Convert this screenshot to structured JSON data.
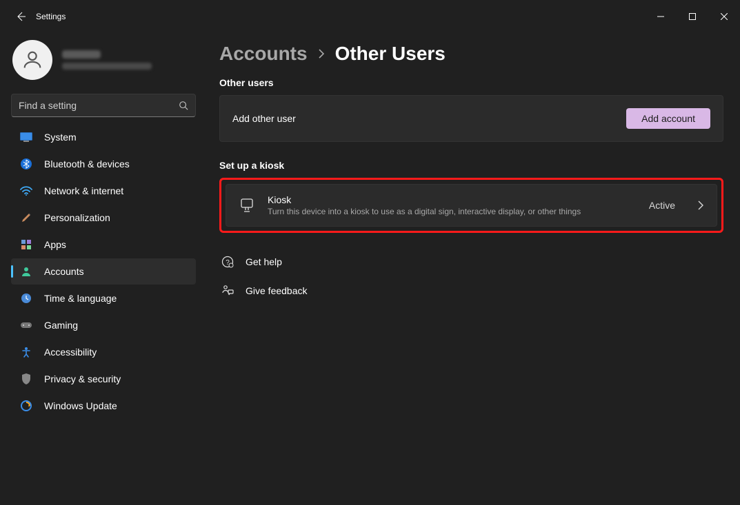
{
  "window": {
    "title": "Settings"
  },
  "search": {
    "placeholder": "Find a setting"
  },
  "sidebar": {
    "items": [
      {
        "label": "System"
      },
      {
        "label": "Bluetooth & devices"
      },
      {
        "label": "Network & internet"
      },
      {
        "label": "Personalization"
      },
      {
        "label": "Apps"
      },
      {
        "label": "Accounts"
      },
      {
        "label": "Time & language"
      },
      {
        "label": "Gaming"
      },
      {
        "label": "Accessibility"
      },
      {
        "label": "Privacy & security"
      },
      {
        "label": "Windows Update"
      }
    ]
  },
  "breadcrumb": {
    "parent": "Accounts",
    "current": "Other Users"
  },
  "sections": {
    "other_users": {
      "heading": "Other users",
      "add_label": "Add other user",
      "add_button": "Add account"
    },
    "kiosk": {
      "heading": "Set up a kiosk",
      "title": "Kiosk",
      "desc": "Turn this device into a kiosk to use as a digital sign, interactive display, or other things",
      "status": "Active"
    }
  },
  "footer": {
    "help": "Get help",
    "feedback": "Give feedback"
  }
}
